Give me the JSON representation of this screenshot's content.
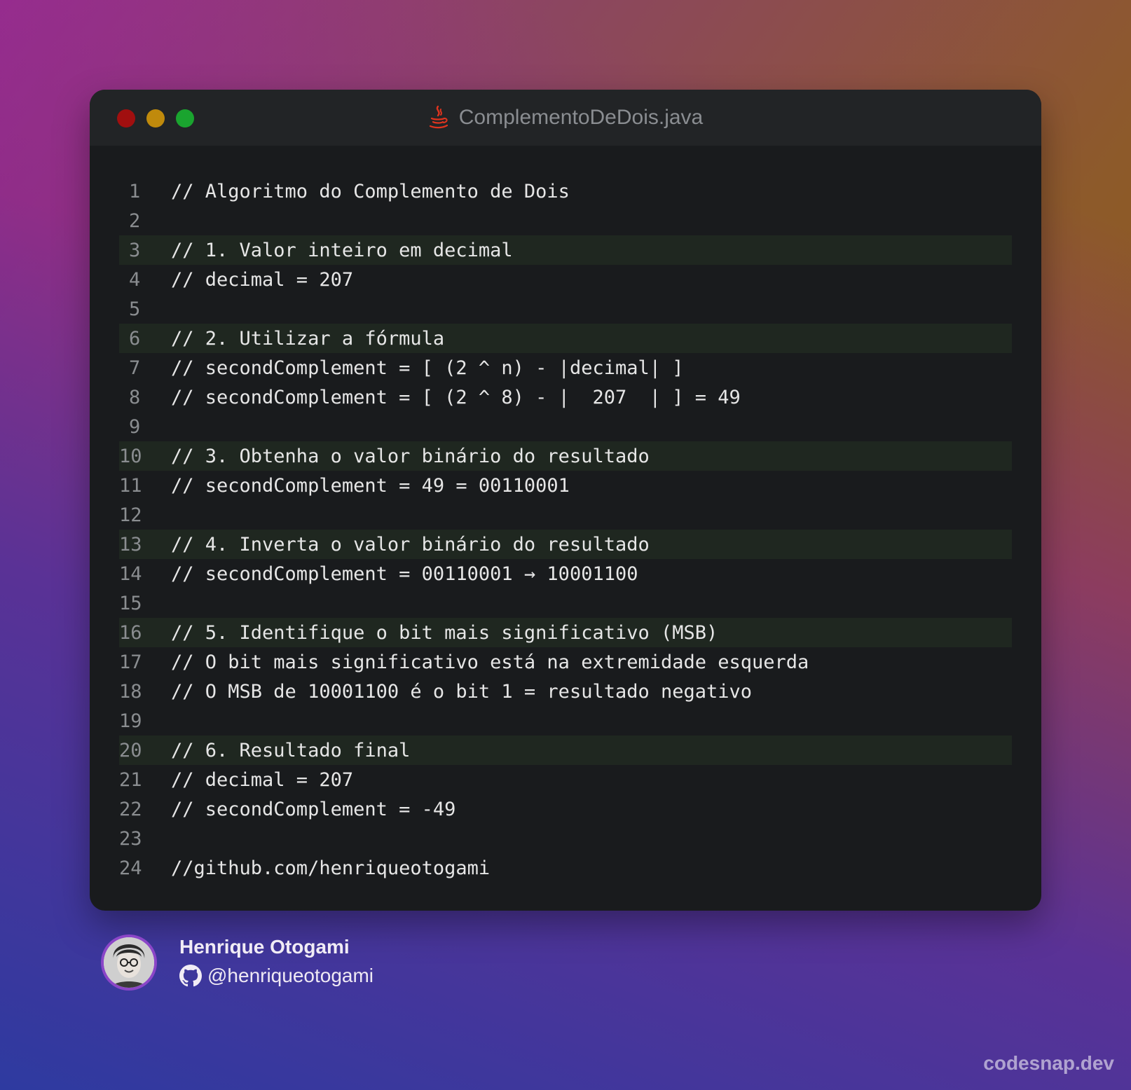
{
  "window": {
    "filename": "ComplementoDeDois.java",
    "file_icon": "java-icon"
  },
  "code": {
    "lines": [
      {
        "n": "1",
        "text": "// Algoritmo do Complemento de Dois",
        "highlight": false
      },
      {
        "n": "2",
        "text": "",
        "highlight": false
      },
      {
        "n": "3",
        "text": "// 1. Valor inteiro em decimal",
        "highlight": true
      },
      {
        "n": "4",
        "text": "// decimal = 207",
        "highlight": false
      },
      {
        "n": "5",
        "text": "",
        "highlight": false
      },
      {
        "n": "6",
        "text": "// 2. Utilizar a fórmula",
        "highlight": true
      },
      {
        "n": "7",
        "text": "// secondComplement = [ (2 ^ n) - |decimal| ]",
        "highlight": false
      },
      {
        "n": "8",
        "text": "// secondComplement = [ (2 ^ 8) - |  207  | ] = 49",
        "highlight": false
      },
      {
        "n": "9",
        "text": "",
        "highlight": false
      },
      {
        "n": "10",
        "text": "// 3. Obtenha o valor binário do resultado",
        "highlight": true
      },
      {
        "n": "11",
        "text": "// secondComplement = 49 = 00110001",
        "highlight": false
      },
      {
        "n": "12",
        "text": "",
        "highlight": false
      },
      {
        "n": "13",
        "text": "// 4. Inverta o valor binário do resultado",
        "highlight": true
      },
      {
        "n": "14",
        "text": "// secondComplement = 00110001 → 10001100",
        "highlight": false
      },
      {
        "n": "15",
        "text": "",
        "highlight": false
      },
      {
        "n": "16",
        "text": "// 5. Identifique o bit mais significativo (MSB)",
        "highlight": true
      },
      {
        "n": "17",
        "text": "// O bit mais significativo está na extremidade esquerda",
        "highlight": false
      },
      {
        "n": "18",
        "text": "// O MSB de 10001100 é o bit 1 = resultado negativo",
        "highlight": false
      },
      {
        "n": "19",
        "text": "",
        "highlight": false
      },
      {
        "n": "20",
        "text": "// 6. Resultado final",
        "highlight": true
      },
      {
        "n": "21",
        "text": "// decimal = 207",
        "highlight": false
      },
      {
        "n": "22",
        "text": "// secondComplement = -49",
        "highlight": false
      },
      {
        "n": "23",
        "text": "",
        "highlight": false
      },
      {
        "n": "24",
        "text": "//github.com/henriqueotogami",
        "highlight": false
      }
    ]
  },
  "author": {
    "name": "Henrique Otogami",
    "handle": "@henriqueotogami",
    "handle_icon": "github-icon",
    "avatar_icon": "avatar-icon"
  },
  "watermark": "codesnap.dev",
  "colors": {
    "window_bg": "#191b1d",
    "titlebar_bg": "#222426",
    "highlight_bg": "#1f2720",
    "close": "#a10f0f",
    "minimize": "#c08a0c",
    "maximize": "#1aa42f"
  }
}
